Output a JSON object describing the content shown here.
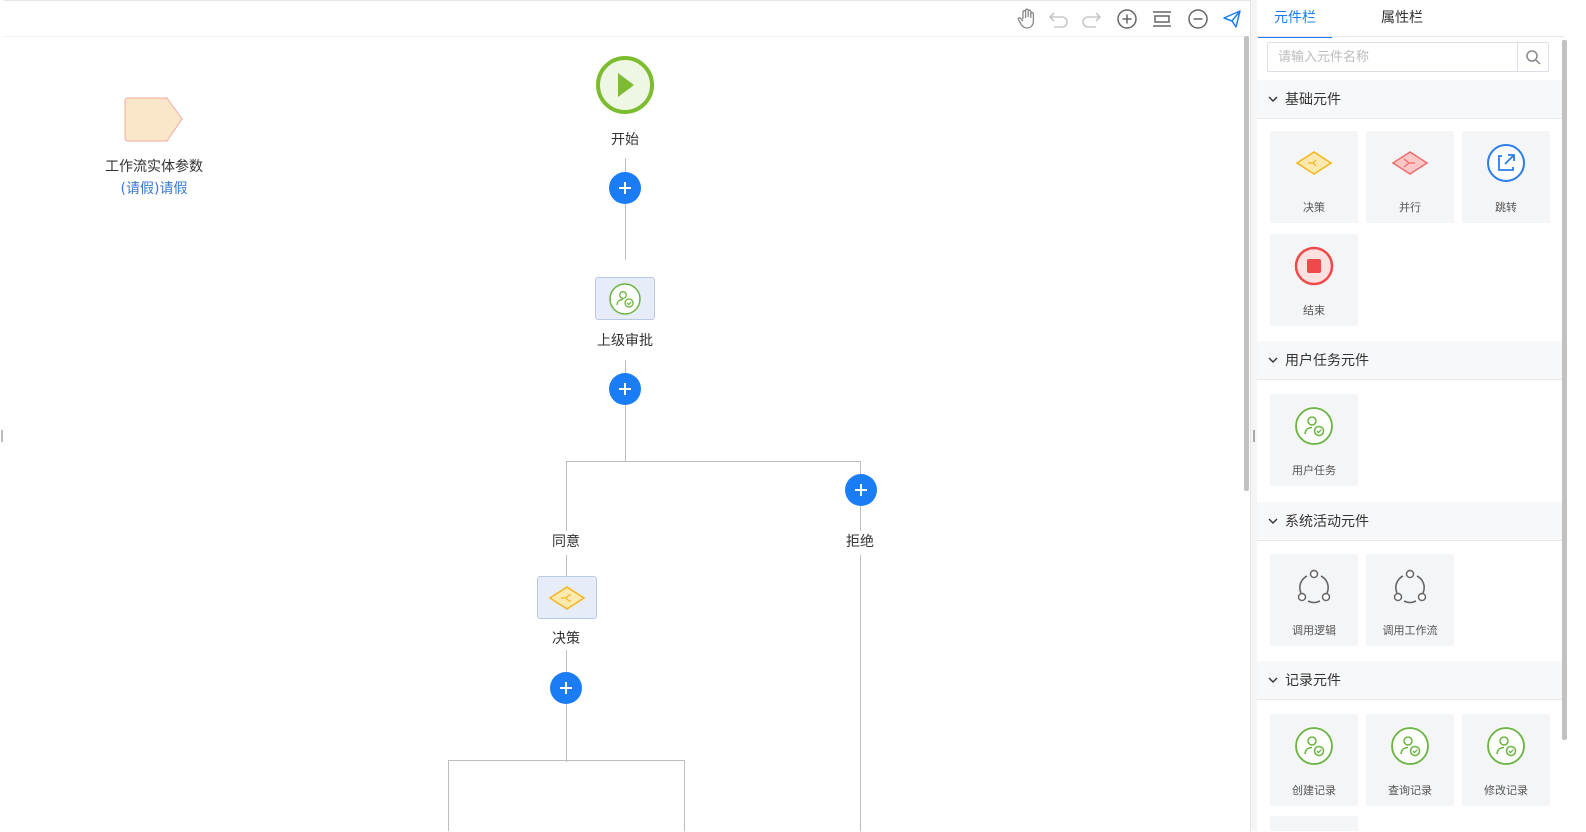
{
  "toolbar": {
    "icons": [
      "hand-icon",
      "undo-icon",
      "redo-icon",
      "zoom-in-icon",
      "fit-icon",
      "zoom-out-icon",
      "publish-icon"
    ]
  },
  "entity": {
    "title": "工作流实体参数",
    "link": "(请假)请假"
  },
  "flow": {
    "start_label": "开始",
    "approve_label": "上级审批",
    "agree_label": "同意",
    "reject_label": "拒绝",
    "decision_label": "决策"
  },
  "panel": {
    "tabs": [
      "元件栏",
      "属性栏"
    ],
    "search_placeholder": "请输入元件名称",
    "sections": [
      {
        "title": "基础元件",
        "items": [
          "决策",
          "并行",
          "跳转",
          "结束"
        ]
      },
      {
        "title": "用户任务元件",
        "items": [
          "用户任务"
        ]
      },
      {
        "title": "系统活动元件",
        "items": [
          "调用逻辑",
          "调用工作流"
        ]
      },
      {
        "title": "记录元件",
        "items": [
          "创建记录",
          "查询记录",
          "修改记录"
        ]
      }
    ]
  },
  "colors": {
    "accent": "#1a7df5",
    "start": "#7cbd2f",
    "user": "#6ab43e",
    "decision": "#f5b41a",
    "parallel": "#f06a6a",
    "end": "#ef4a4a"
  }
}
